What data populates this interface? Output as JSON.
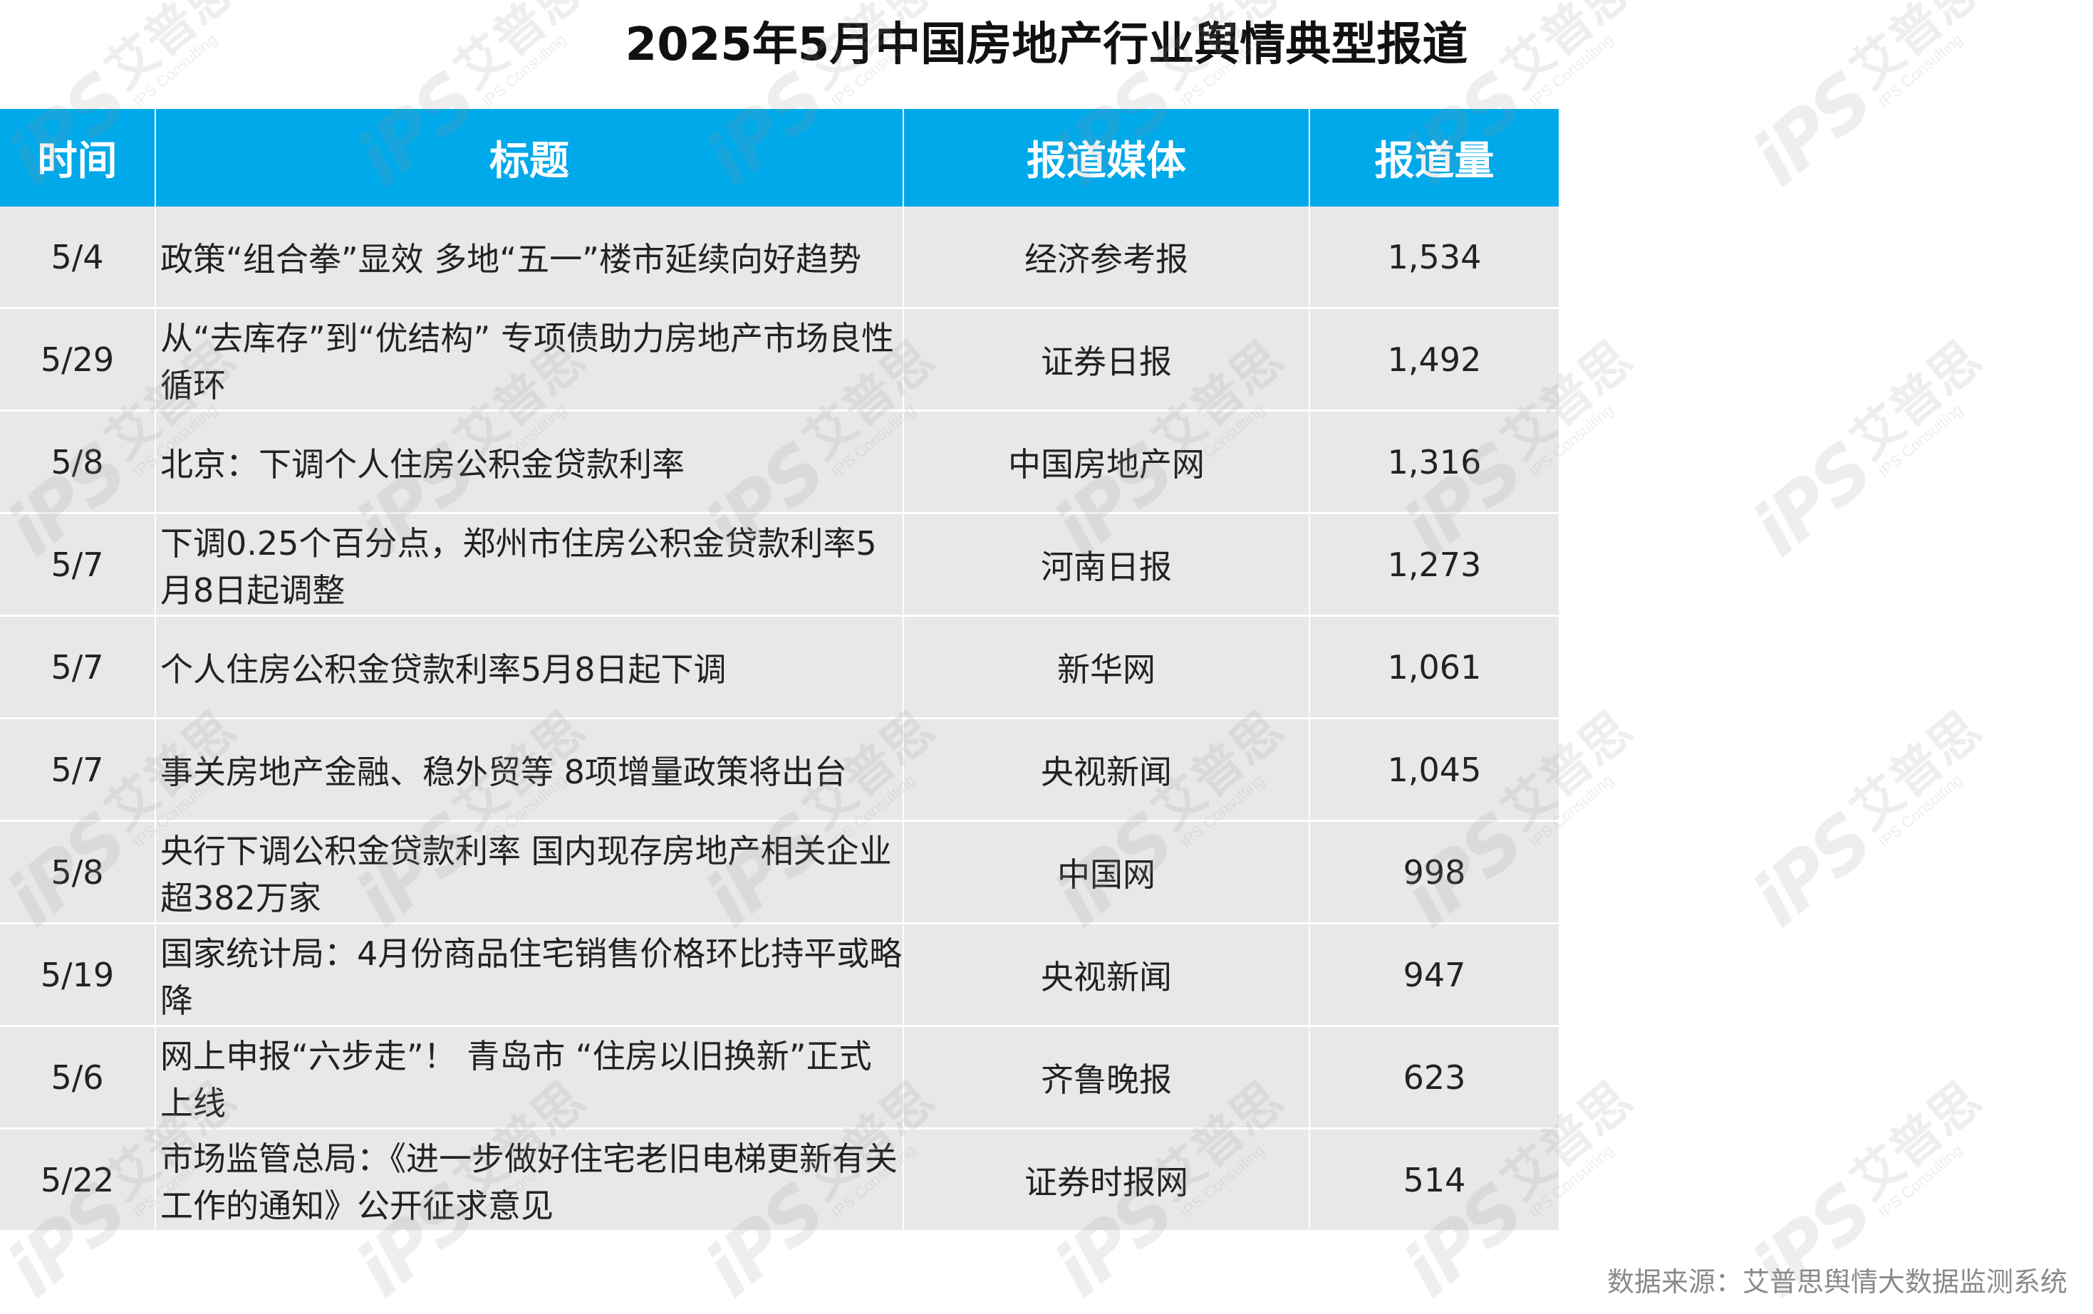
{
  "title": "2025年5月中国房地产行业舆情典型报道",
  "table": {
    "headers": [
      "时间",
      "标题",
      "报道媒体",
      "报道量"
    ],
    "rows": [
      {
        "date": "5/4",
        "title": "政策“组合拳”显效 多地“五一”楼市延续向好趋势",
        "media": "经济参考报",
        "count": "1,534"
      },
      {
        "date": "5/29",
        "title": "从“去库存”到“优结构” 专项债助力房地产市场良性循环",
        "media": "证券日报",
        "count": "1,492"
      },
      {
        "date": "5/8",
        "title": "北京：下调个人住房公积金贷款利率",
        "media": "中国房地产网",
        "count": "1,316"
      },
      {
        "date": "5/7",
        "title": "下调0.25个百分点，郑州市住房公积金贷款利率5月8日起调整",
        "media": "河南日报",
        "count": "1,273"
      },
      {
        "date": "5/7",
        "title": "个人住房公积金贷款利率5月8日起下调",
        "media": "新华网",
        "count": "1,061"
      },
      {
        "date": "5/7",
        "title": "事关房地产金融、稳外贸等 8项增量政策将出台",
        "media": "央视新闻",
        "count": "1,045"
      },
      {
        "date": "5/8",
        "title": "央行下调公积金贷款利率 国内现存房地产相关企业超382万家",
        "media": "中国网",
        "count": "998"
      },
      {
        "date": "5/19",
        "title": "国家统计局：4月份商品住宅销售价格环比持平或略降",
        "media": "央视新闻",
        "count": "947"
      },
      {
        "date": "5/6",
        "title": "网上申报“六步走”！ 青岛市 “住房以旧换新”正式上线",
        "media": "齐鲁晚报",
        "count": "623"
      },
      {
        "date": "5/22",
        "title": "市场监管总局：《进一步做好住宅老旧电梯更新有关工作的通知》公开征求意见",
        "media": "证券时报网",
        "count": "514"
      }
    ]
  },
  "source": "数据来源：艾普思舆情大数据监测系统",
  "watermark": {
    "logo": "iPS",
    "cn": "艾普思",
    "en": "IPS Consulting"
  },
  "colors": {
    "header_bg": "#00a9ea",
    "row_bg": "#e8e8e8",
    "source_text": "#8a8a8a"
  }
}
